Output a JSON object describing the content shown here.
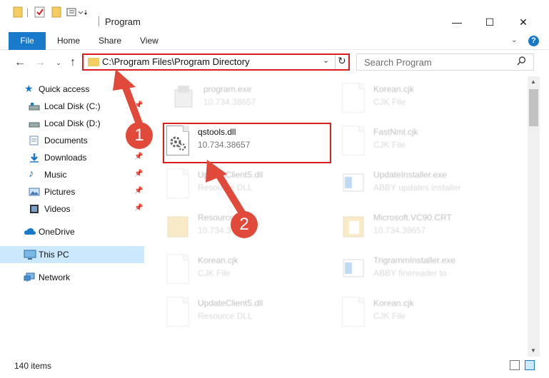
{
  "window": {
    "title": "Program",
    "minimize": "—",
    "maximize": "☐",
    "close": "✕"
  },
  "ribbon": {
    "tabs": [
      "File",
      "Home",
      "Share",
      "View"
    ],
    "help": "?"
  },
  "address": {
    "path": "C:\\Program Files\\Program Directory"
  },
  "search": {
    "placeholder": "Search Program"
  },
  "sidebar": {
    "items": [
      {
        "label": "Quick access",
        "icon": "star-icon"
      },
      {
        "label": "Local Disk (C:)",
        "icon": "drive-icon"
      },
      {
        "label": "Local Disk (D:)",
        "icon": "drive-icon"
      },
      {
        "label": "Documents",
        "icon": "documents-icon"
      },
      {
        "label": "Downloads",
        "icon": "download-icon"
      },
      {
        "label": "Music",
        "icon": "music-icon"
      },
      {
        "label": "Pictures",
        "icon": "pictures-icon"
      },
      {
        "label": "Videos",
        "icon": "videos-icon"
      },
      {
        "label": "OneDrive",
        "icon": "cloud-icon"
      },
      {
        "label": "This PC",
        "icon": "pc-icon"
      },
      {
        "label": "Network",
        "icon": "network-icon"
      }
    ]
  },
  "files": [
    {
      "name": "program.exe",
      "sub": "10.734.38657",
      "icon": "exe"
    },
    {
      "name": "Korean.cjk",
      "sub": "CJK File",
      "icon": "doc"
    },
    {
      "name": "qstools.dll",
      "sub": "10.734.38657",
      "icon": "dll"
    },
    {
      "name": "FastNml.cjk",
      "sub": "CJK File",
      "icon": "doc"
    },
    {
      "name": "UpdateClient5.dll",
      "sub": "Resource DLL",
      "icon": "dll"
    },
    {
      "name": "UpdateInstaller.exe",
      "sub": "ABBY updates installer",
      "icon": "exe-blue"
    },
    {
      "name": "Resource",
      "sub": "10.734.3",
      "icon": "folder"
    },
    {
      "name": "Microsoft.VC90.CRT",
      "sub": "10.734.38657",
      "icon": "folder"
    },
    {
      "name": "Korean.cjk",
      "sub": "CJK File",
      "icon": "doc"
    },
    {
      "name": "TrigrammInstaller.exe",
      "sub": "ABBY finereader to",
      "icon": "exe-blue"
    },
    {
      "name": "UpdateClient5.dll",
      "sub": "Resource DLL",
      "icon": "dll"
    },
    {
      "name": "Korean.cjk",
      "sub": "CJK File",
      "icon": "doc"
    }
  ],
  "annotations": {
    "badge1": "1",
    "badge2": "2"
  },
  "status": {
    "items": "140 items"
  },
  "colors": {
    "accent": "#1979ca",
    "highlight": "#d81f1f",
    "badge": "#e14a3b",
    "selected": "#cce8ff"
  }
}
